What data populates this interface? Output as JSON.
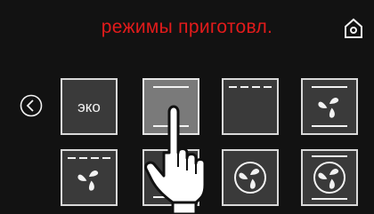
{
  "header": {
    "title": "режимы приготовл."
  },
  "icons": {
    "home": "home-icon",
    "back": "chevron-left-circle-icon",
    "fan": "fan-icon",
    "hand": "pointing-hand-icon"
  },
  "modes": [
    {
      "id": "eco",
      "label": "эко",
      "row": 1
    },
    {
      "id": "top-bottom-heat",
      "label": "",
      "row": 1,
      "selected": true
    },
    {
      "id": "top-heat-dashed",
      "label": "",
      "row": 1
    },
    {
      "id": "fan-top-bottom",
      "label": "",
      "row": 1
    },
    {
      "id": "fan-top-dashed",
      "label": "",
      "row": 2
    },
    {
      "id": "fan-ring-bottom",
      "label": "",
      "row": 2
    },
    {
      "id": "fan-ring",
      "label": "",
      "row": 2
    },
    {
      "id": "fan-ring-top-bottom",
      "label": "",
      "row": 2
    }
  ],
  "colors": {
    "title": "#e21b1b",
    "background": "#121212",
    "tile": "#3a3a3a",
    "tile_selected": "#7a7a7a",
    "icon": "#f2f2f2"
  }
}
